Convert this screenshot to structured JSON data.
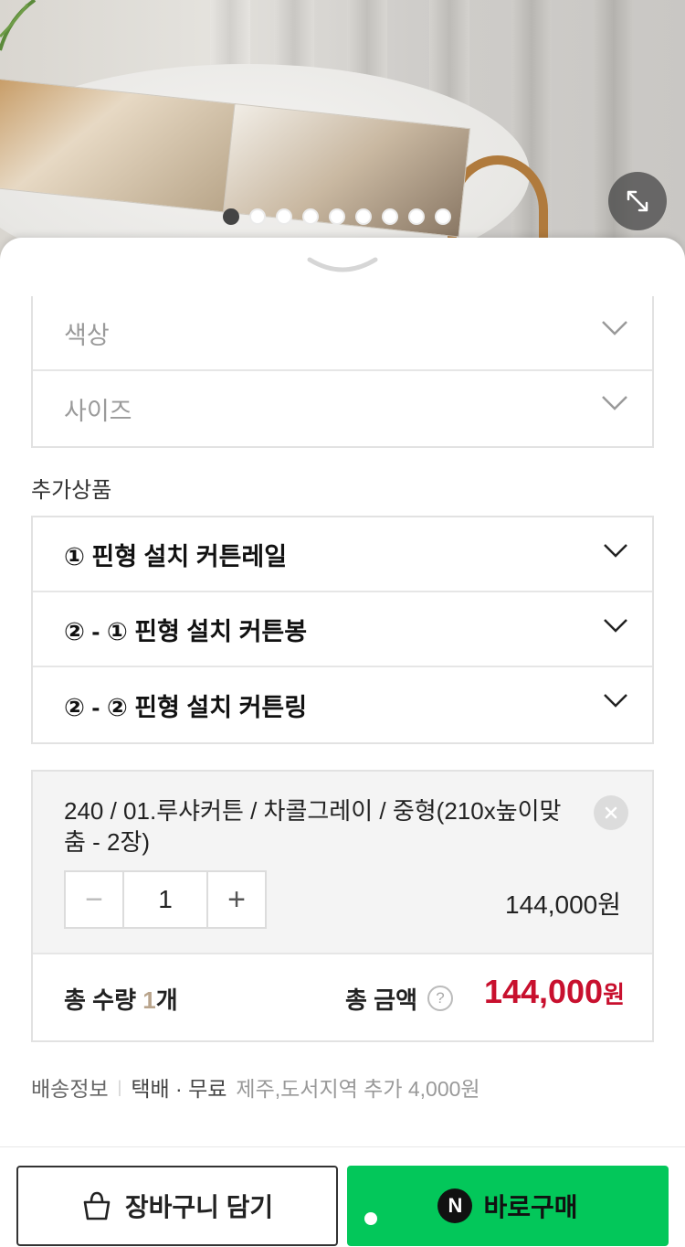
{
  "gallery": {
    "slide_count": 9,
    "active_index": 0
  },
  "options": [
    {
      "label": "색상"
    },
    {
      "label": "사이즈"
    }
  ],
  "addons": {
    "title": "추가상품",
    "items": [
      {
        "label": "① 핀형 설치 커튼레일"
      },
      {
        "label": "② - ① 핀형 설치 커튼봉"
      },
      {
        "label": "② - ② 핀형 설치 커튼링"
      }
    ]
  },
  "cart": {
    "item_name": "240 / 01.루샤커튼 / 차콜그레이 / 중형(210x높이맞춤 - 2장)",
    "quantity": "1",
    "minus": "−",
    "plus": "+",
    "price": "144,000원",
    "total_qty_label": "총 수량 ",
    "total_qty_value": "1",
    "total_qty_unit": "개",
    "total_amount_label": "총 금액",
    "help_icon": "?",
    "total_amount_value": "144,000",
    "total_amount_unit": "원"
  },
  "shipping": {
    "label": "배송정보",
    "separator": "|",
    "method": "택배 · 무료",
    "extra": "제주,도서지역 추가 4,000원"
  },
  "buttons": {
    "add_to_cart": "장바구니 담기",
    "buy_now": "바로구매",
    "buy_badge": "N"
  },
  "colors": {
    "accent_price": "#c8102e",
    "buy_button": "#03c75a",
    "qty_number": "#b9a48c"
  }
}
